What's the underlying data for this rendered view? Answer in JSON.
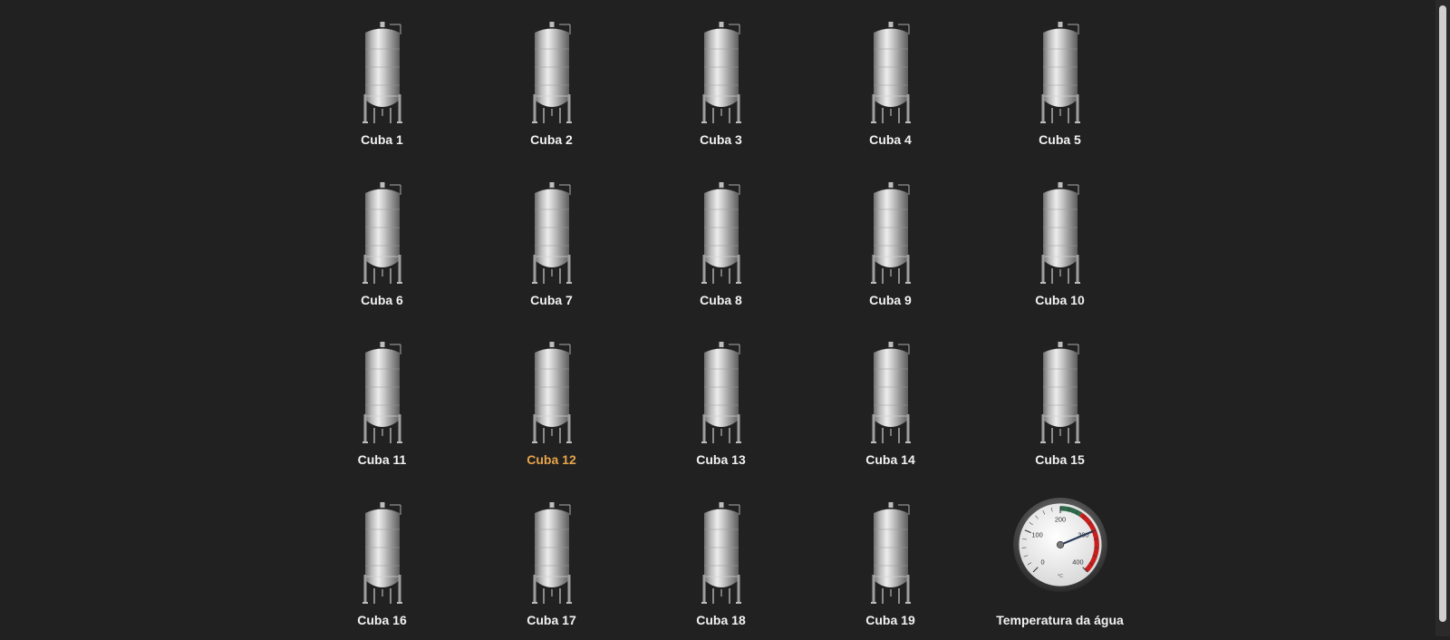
{
  "tanks": [
    {
      "label": "Cuba 1"
    },
    {
      "label": "Cuba 2"
    },
    {
      "label": "Cuba 3"
    },
    {
      "label": "Cuba 4"
    },
    {
      "label": "Cuba 5"
    },
    {
      "label": "Cuba 6"
    },
    {
      "label": "Cuba 7"
    },
    {
      "label": "Cuba 8"
    },
    {
      "label": "Cuba 9"
    },
    {
      "label": "Cuba 10"
    },
    {
      "label": "Cuba 11"
    },
    {
      "label": "Cuba 12"
    },
    {
      "label": "Cuba 13"
    },
    {
      "label": "Cuba 14"
    },
    {
      "label": "Cuba 15"
    },
    {
      "label": "Cuba 16"
    },
    {
      "label": "Cuba 17"
    },
    {
      "label": "Cuba 18"
    },
    {
      "label": "Cuba 19"
    }
  ],
  "active_tank_index": 11,
  "colors": {
    "background": "#212121",
    "label": "#f2f2f2",
    "active_label": "#e8a44b",
    "gauge_red_zone": "#c81e1e",
    "gauge_green_zone": "#2e6b4a"
  },
  "gauge": {
    "label": "Temperatura da água",
    "ticks": [
      "0",
      "100",
      "200",
      "300",
      "400"
    ],
    "unit": "°C",
    "value": 300
  }
}
